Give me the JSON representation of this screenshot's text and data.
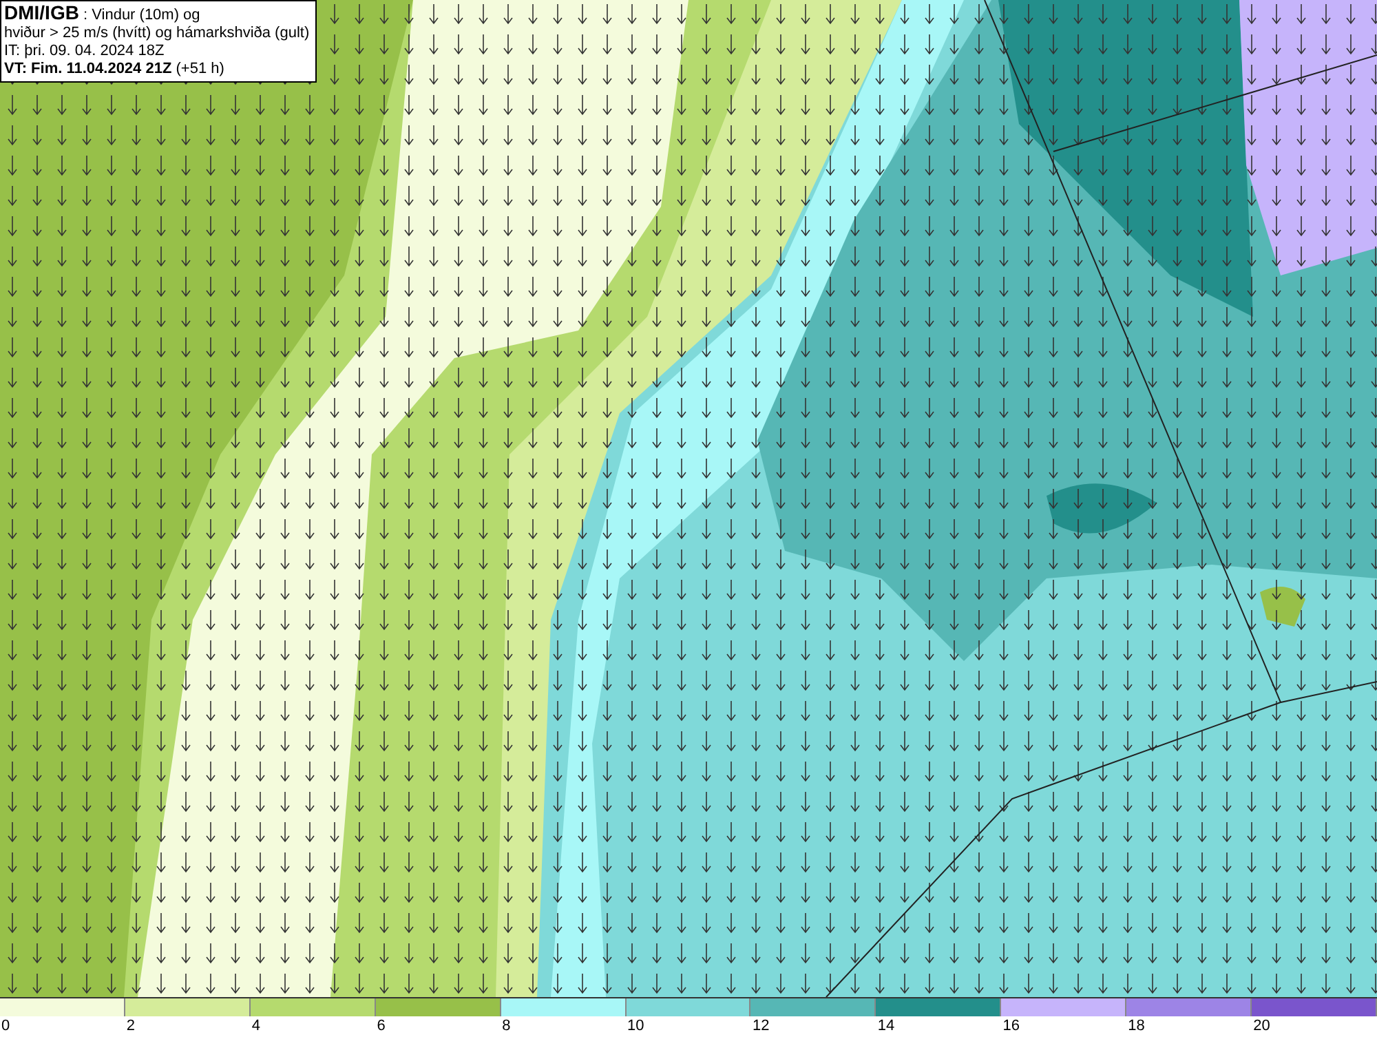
{
  "header": {
    "lines": [
      "**DMI/IGB** : Vindur (10m) og",
      "hviður > 25 m/s (hvítt) og hámarkshviða (gult)",
      "IT: þri. 09. 04. 2024 18Z",
      "**VT: Fim. 11.04.2024 21Z** (+51 h)"
    ]
  },
  "legend": {
    "bins": [
      {
        "color": "#f4fbdc",
        "label": "0"
      },
      {
        "color": "#d5ec9a",
        "label": "2"
      },
      {
        "color": "#b5da6e",
        "label": "4"
      },
      {
        "color": "#97c049",
        "label": "6"
      },
      {
        "color": "#a8f7f7",
        "label": "8"
      },
      {
        "color": "#7fd9d9",
        "label": "10"
      },
      {
        "color": "#56b7b5",
        "label": "12"
      },
      {
        "color": "#238f8b",
        "label": "14"
      },
      {
        "color": "#c6b4fb",
        "label": "16"
      },
      {
        "color": "#9d84e6",
        "label": "18"
      },
      {
        "color": "#7a55cc",
        "label": "20"
      }
    ]
  }
}
